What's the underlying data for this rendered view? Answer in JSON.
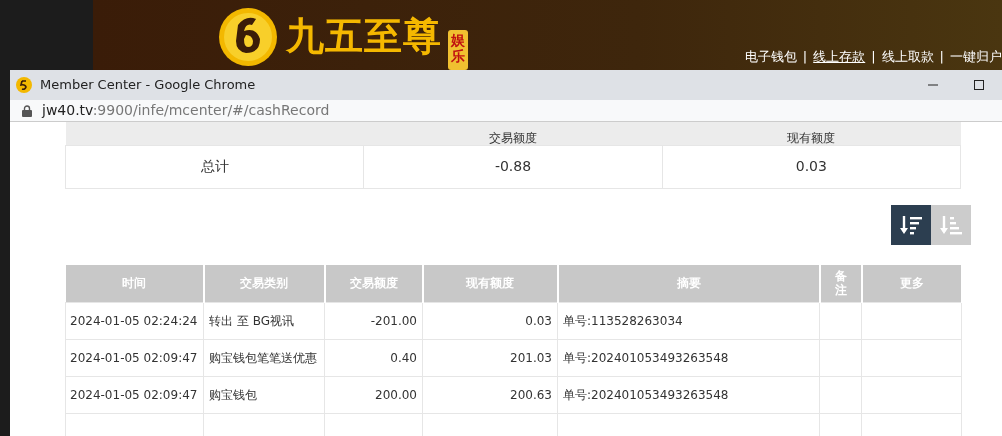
{
  "site_header": {
    "logo_text": "九五至尊",
    "logo_badge": "娱乐",
    "nav_links": [
      {
        "label": "电子钱包",
        "selected": false
      },
      {
        "label": "线上存款",
        "selected": true
      },
      {
        "label": "线上取款",
        "selected": false
      },
      {
        "label": "一键归户",
        "selected": false
      }
    ],
    "separator": "|"
  },
  "window": {
    "title": "Member Center - Google Chrome",
    "url_host": "jw40.tv",
    "url_rest": ":9900/infe/mcenter/#/cashRecord"
  },
  "summary": {
    "columns": [
      "",
      "交易额度",
      "现有额度"
    ],
    "rows": [
      [
        "总计",
        "-0.88",
        "0.03"
      ]
    ]
  },
  "sort_buttons": [
    {
      "kind": "desc",
      "selected": true
    },
    {
      "kind": "asc",
      "selected": false
    }
  ],
  "table": {
    "columns": [
      "时间",
      "交易类别",
      "交易额度",
      "现有额度",
      "摘要",
      "备注",
      "更多"
    ],
    "rows": [
      [
        "2024-01-05 02:24:24",
        "转出 至 BG视讯",
        "-201.00",
        "0.03",
        "单号:113528263034",
        "",
        ""
      ],
      [
        "2024-01-05 02:09:47",
        "购宝钱包笔笔送优惠",
        "0.40",
        "201.03",
        "单号:202401053493263548",
        "",
        ""
      ],
      [
        "2024-01-05 02:09:47",
        "购宝钱包",
        "200.00",
        "200.63",
        "单号:202401053493263548",
        "",
        ""
      ]
    ]
  }
}
